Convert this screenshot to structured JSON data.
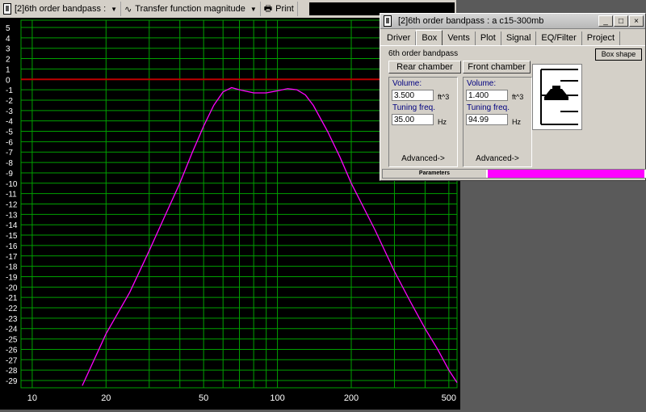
{
  "toolbar": {
    "project_label": "[2]6th order bandpass :",
    "view_label": "Transfer function magnitude",
    "print_label": "Print"
  },
  "chart_data": {
    "type": "line",
    "title": "",
    "xlabel": "",
    "ylabel": "",
    "xscale": "log",
    "xlim": [
      9,
      540
    ],
    "ylim": [
      -30,
      5
    ],
    "x_ticks": [
      10,
      20,
      50,
      100,
      200,
      500
    ],
    "y_ticks": [
      5,
      4,
      3,
      2,
      1,
      0,
      -1,
      -2,
      -3,
      -4,
      -5,
      -6,
      -7,
      -8,
      -9,
      -10,
      -11,
      -12,
      -13,
      -14,
      -15,
      -16,
      -17,
      -18,
      -19,
      -20,
      -21,
      -22,
      -23,
      -24,
      -25,
      -26,
      -27,
      -28,
      -29
    ],
    "reference_line_y": 0,
    "grid": true,
    "colors": {
      "background": "#000000",
      "grid": "#00a000",
      "curve": "#ff00ff",
      "reference": "#c00000",
      "labels": "#ffffff"
    },
    "series": [
      {
        "x": [
          16,
          20,
          25,
          30,
          35,
          40,
          45,
          50,
          55,
          60,
          65,
          70,
          80,
          90,
          100,
          110,
          120,
          130,
          140,
          160,
          180,
          200,
          250,
          300,
          350,
          400,
          450,
          500,
          540
        ],
        "y": [
          -29.5,
          -24.5,
          -20.5,
          -16.5,
          -13,
          -10,
          -7,
          -4.5,
          -2.5,
          -1.2,
          -0.8,
          -1.0,
          -1.3,
          -1.3,
          -1.1,
          -0.9,
          -1.0,
          -1.5,
          -2.5,
          -5,
          -7.5,
          -10,
          -14.5,
          -18.5,
          -21.5,
          -24,
          -26,
          -28,
          -29.2
        ]
      }
    ]
  },
  "dialog": {
    "title": "[2]6th order bandpass : a c15-300mb",
    "tabs": [
      "Driver",
      "Box",
      "Vents",
      "Plot",
      "Signal",
      "EQ/Filter",
      "Project"
    ],
    "active_tab": "Box",
    "box_type": "6th order bandpass",
    "box_shape_label": "Box shape",
    "rear": {
      "button": "Rear chamber",
      "volume_label": "Volume:",
      "volume": "3.500",
      "volume_unit": "ft^3",
      "tuning_label": "Tuning freq.",
      "tuning": "35.00",
      "tuning_unit": "Hz",
      "advanced": "Advanced->"
    },
    "front": {
      "button": "Front chamber",
      "volume_label": "Volume:",
      "volume": "1.400",
      "volume_unit": "ft^3",
      "tuning_label": "Tuning freq.",
      "tuning": "94.99",
      "tuning_unit": "Hz",
      "advanced": "Advanced->"
    },
    "status_label": "Parameters",
    "status_color": "#ff00ff"
  }
}
